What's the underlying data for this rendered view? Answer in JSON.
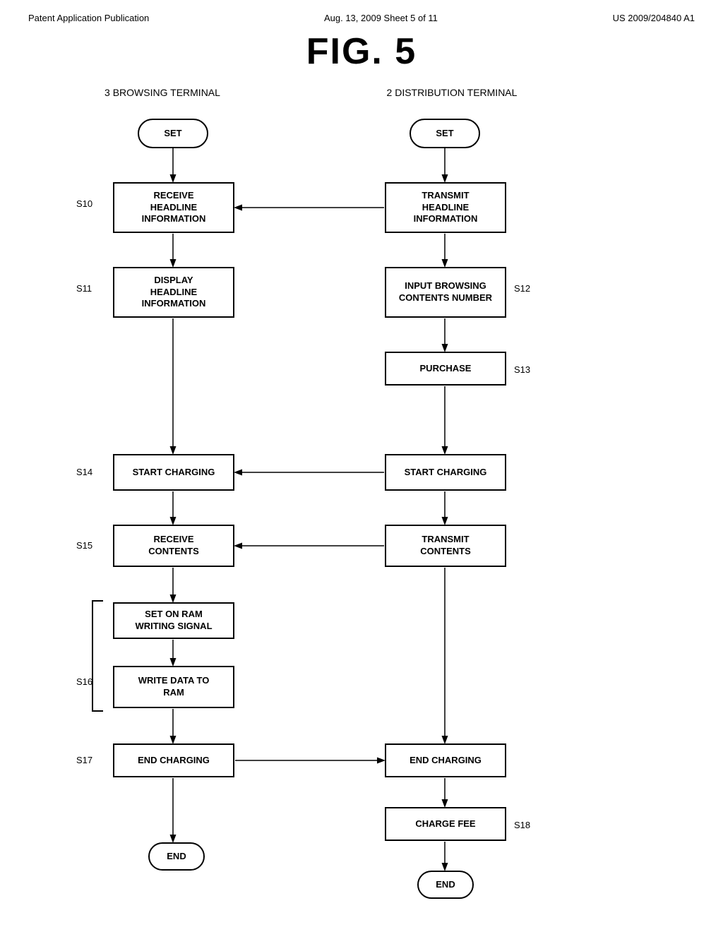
{
  "header": {
    "left": "Patent Application Publication",
    "middle": "Aug. 13, 2009   Sheet 5 of 11",
    "right": "US 2009/204840 A1"
  },
  "fig_title": "FIG. 5",
  "col_left_label": "3 BROWSING TERMINAL",
  "col_right_label": "2 DISTRIBUTION TERMINAL",
  "steps": {
    "s10": "S10",
    "s11": "S11",
    "s12": "S12",
    "s13": "S13",
    "s14": "S14",
    "s15": "S15",
    "s16": "S16",
    "s17": "S17",
    "s18": "S18"
  },
  "boxes": {
    "left_set": "SET",
    "right_set": "SET",
    "receive_headline": "RECEIVE\nHEADLINE\nINFORMATION",
    "transmit_headline": "TRANSMIT\nHEADLINE\nINFORMATION",
    "display_headline": "DISPLAY\nHEADLINE\nINFORMATION",
    "input_browsing": "INPUT BROWSING\nCONTENTS NUMBER",
    "purchase": "PURCHASE",
    "start_charging_left": "START CHARGING",
    "start_charging_right": "START CHARGING",
    "receive_contents": "RECEIVE\nCONTENTS",
    "transmit_contents": "TRANSMIT\nCONTENTS",
    "set_on_ram": "SET ON RAM\nWRITING SIGNAL",
    "write_data": "WRITE DATA TO\nRAM",
    "end_charging_left": "END CHARGING",
    "end_charging_right": "END CHARGING",
    "charge_fee": "CHARGE FEE",
    "end_left": "END",
    "end_right": "END"
  }
}
